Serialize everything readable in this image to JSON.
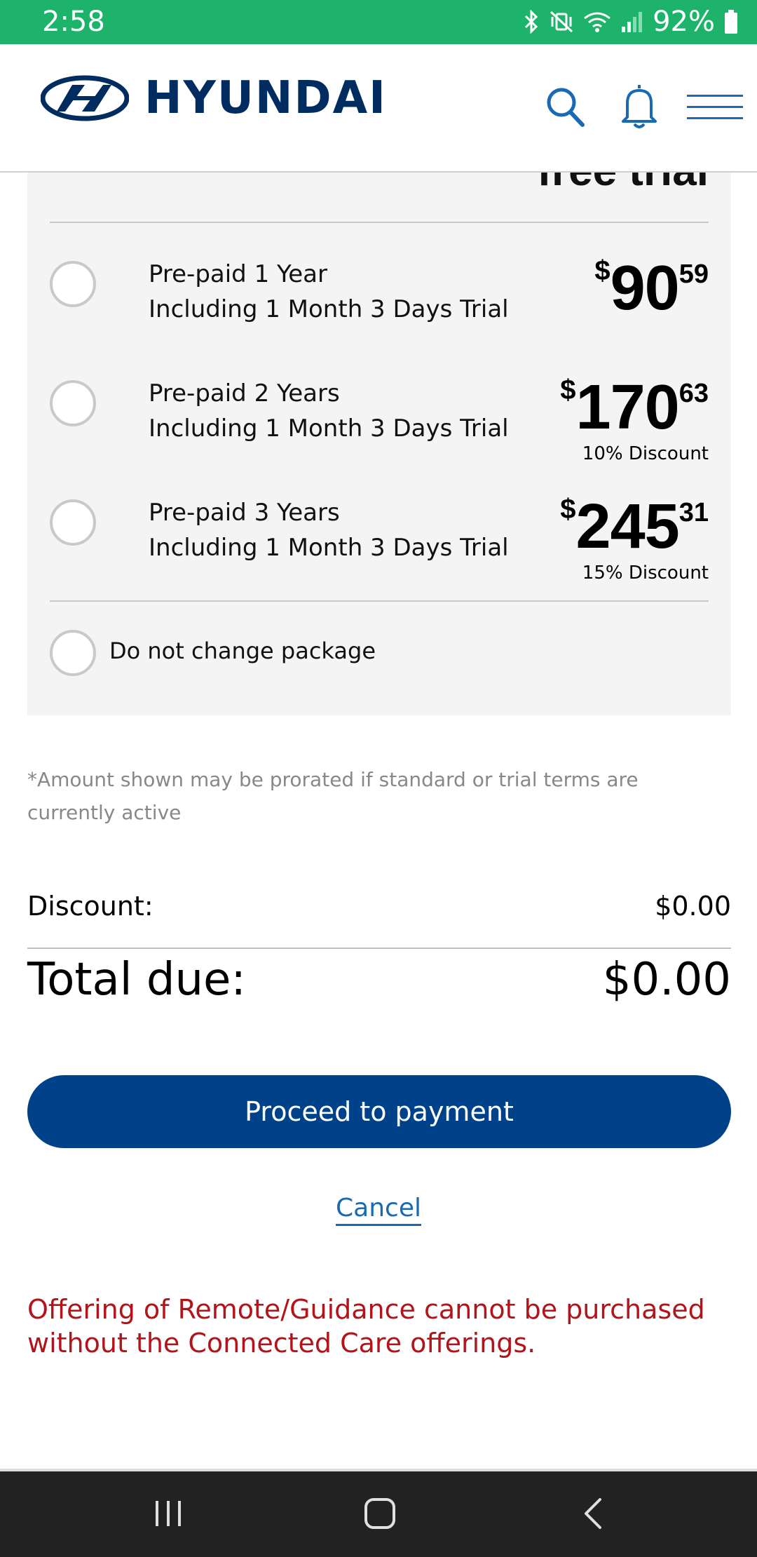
{
  "status_bar": {
    "time": "2:58",
    "battery": "92%",
    "icons": [
      "bluetooth-icon",
      "mute-vibrate-icon",
      "wifi-icon",
      "signal-icon",
      "battery-icon"
    ]
  },
  "header": {
    "brand": "HYUNDAI",
    "icons": [
      "search-icon",
      "bell-icon",
      "menu-icon"
    ],
    "brand_color": "#002c5f",
    "icon_color": "#1a6ab3"
  },
  "packages": {
    "cut_heading": "free trial",
    "options": [
      {
        "title": "Pre-paid 1 Year",
        "subtitle": "Including 1 Month 3 Days Trial",
        "currency": "$",
        "price_whole": "90",
        "price_cents": "59",
        "note": ""
      },
      {
        "title": "Pre-paid 2 Years",
        "subtitle": "Including 1 Month 3 Days Trial",
        "currency": "$",
        "price_whole": "170",
        "price_cents": "63",
        "note": "10% Discount"
      },
      {
        "title": "Pre-paid 3 Years",
        "subtitle": "Including 1 Month 3 Days Trial",
        "currency": "$",
        "price_whole": "245",
        "price_cents": "31",
        "note": "15% Discount"
      }
    ],
    "no_change_label": "Do not change package"
  },
  "proration_note": "*Amount shown may be prorated if standard or trial terms are currently active",
  "summary": {
    "discount_label": "Discount:",
    "discount_value": "$0.00",
    "total_label": "Total due:",
    "total_value": "$0.00"
  },
  "actions": {
    "proceed_label": "Proceed to payment",
    "cancel_label": "Cancel"
  },
  "error_message": "Offering of Remote/Guidance cannot be purchased without the Connected Care offerings.",
  "colors": {
    "status_bar": "#1db36a",
    "primary_button": "#00428a",
    "link": "#1a6ab3",
    "error": "#b3141a"
  },
  "nav_bar": {
    "icons": [
      "recent-apps-icon",
      "home-icon",
      "back-icon"
    ]
  }
}
